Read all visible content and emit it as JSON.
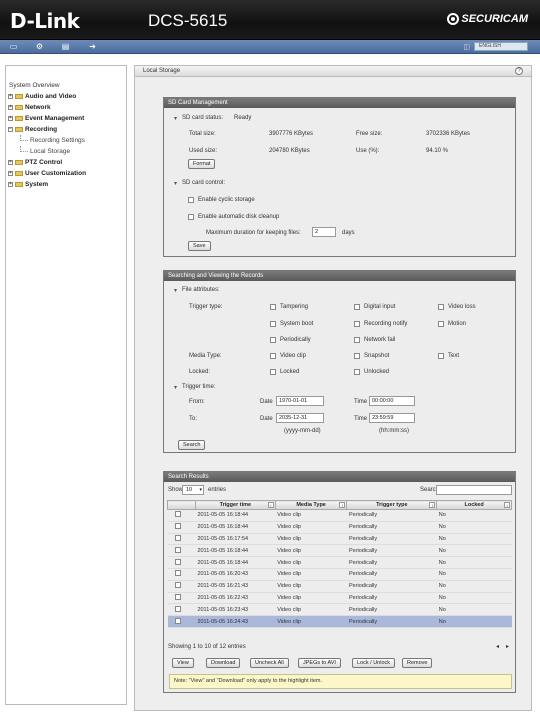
{
  "header": {
    "logo": "D-Link",
    "model": "DCS-5615",
    "brand": "SECURICAM"
  },
  "toolbar": {
    "language": "ENGLISH"
  },
  "sidebar": {
    "root": "System Overview",
    "items": [
      {
        "label": "Audio and Video",
        "level": 0
      },
      {
        "label": "Network",
        "level": 0
      },
      {
        "label": "Event Management",
        "level": 0
      },
      {
        "label": "Recording",
        "level": 0
      },
      {
        "label": "Recording Settings",
        "level": 1
      },
      {
        "label": "Local Storage",
        "level": 1
      },
      {
        "label": "PTZ Control",
        "level": 0
      },
      {
        "label": "User Customization",
        "level": 0
      },
      {
        "label": "System",
        "level": 0
      }
    ]
  },
  "main": {
    "title": "Local Storage",
    "help": "?"
  },
  "sd_panel": {
    "title": "SD Card Management",
    "status_label": "SD card status:",
    "status_value": "Ready",
    "total_label": "Total size:",
    "total_value": "3907776 KBytes",
    "free_label": "Free size:",
    "free_value": "3702336 KBytes",
    "used_label": "Used size:",
    "used_value": "204780 KBytes",
    "use_pct_label": "Use (%):",
    "use_pct_value": "94.10 %",
    "format_button": "Format",
    "control_label": "SD card control:",
    "enable_label": "Enable cyclic storage",
    "cleanup_label": "Enable automatic disk cleanup",
    "max_duration_label": "Maximum duration for keeping files:",
    "max_duration_value": "2",
    "days_label": "days",
    "save_button": "Save"
  },
  "search_panel": {
    "title": "Searching and Viewing the Records",
    "file_attr_label": "File attributes:",
    "trigger_type_label": "Trigger type:",
    "trigger_options": [
      "Tampering",
      "Digital input",
      "Video loss",
      "System boot",
      "Recording notify",
      "Motion",
      "Periodically",
      "Network fail"
    ],
    "media_type_label": "Media Type:",
    "media_options": [
      "Video clip",
      "Snapshot",
      "Text"
    ],
    "locked_label": "Locked:",
    "locked_options": [
      "Locked",
      "Unlocked"
    ],
    "trigger_time_label": "Trigger time:",
    "from_label": "From:",
    "to_label": "To:",
    "date_label": "Date",
    "time_label": "Time",
    "from_date": "1970-01-01",
    "from_time": "00:00:00",
    "to_date": "2035-12-31",
    "to_time": "23:59:59",
    "date_format": "(yyyy-mm-dd)",
    "time_format": "(hh:mm:ss)",
    "search_button": "Search"
  },
  "results": {
    "title": "Search Results",
    "show_label": "Show",
    "show_value": "10",
    "entries_label": "entries",
    "search_label": "Search:",
    "columns": [
      "",
      "Trigger time",
      "Media Type",
      "Trigger type",
      "Locked"
    ],
    "rows": [
      [
        "2011-05-05 16:18:44",
        "Video clip",
        "Periodically",
        "No"
      ],
      [
        "2011-05-05 16:18:44",
        "Video clip",
        "Periodically",
        "No"
      ],
      [
        "2011-05-05 16:17:54",
        "Video clip",
        "Periodically",
        "No"
      ],
      [
        "2011-05-05 16:18:44",
        "Video clip",
        "Periodically",
        "No"
      ],
      [
        "2011-05-05 16:18:44",
        "Video clip",
        "Periodically",
        "No"
      ],
      [
        "2011-05-05 16:20:43",
        "Video clip",
        "Periodically",
        "No"
      ],
      [
        "2011-05-05 16:21:43",
        "Video clip",
        "Periodically",
        "No"
      ],
      [
        "2011-05-05 16:22:43",
        "Video clip",
        "Periodically",
        "No"
      ],
      [
        "2011-05-05 16:23:43",
        "Video clip",
        "Periodically",
        "No"
      ],
      [
        "2011-05-05 16:24:43",
        "Video clip",
        "Periodically",
        "No"
      ]
    ],
    "showing_text": "Showing 1 to 10 of 12 entries",
    "buttons": [
      "View",
      "Download",
      "Uncheck All",
      "JPEGs to AVI",
      "Lock / Unlock",
      "Remove"
    ],
    "note": "Note: \"View\" and \"Download\" only apply to the highlight item."
  }
}
